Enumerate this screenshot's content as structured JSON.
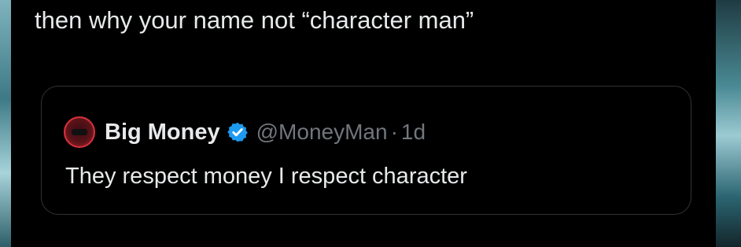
{
  "reply": {
    "text": "then why your name not “character man”"
  },
  "quote": {
    "author_name": "Big Money",
    "verified_icon": "verified-badge-icon",
    "handle": "@MoneyMan",
    "separator": "·",
    "age": "1d",
    "text": "They respect money I respect character"
  },
  "colors": {
    "background": "#000000",
    "primary_text": "#e7e9ea",
    "secondary_text": "#71767b",
    "card_border": "#2f3336",
    "verified_blue": "#1d9bf0"
  }
}
